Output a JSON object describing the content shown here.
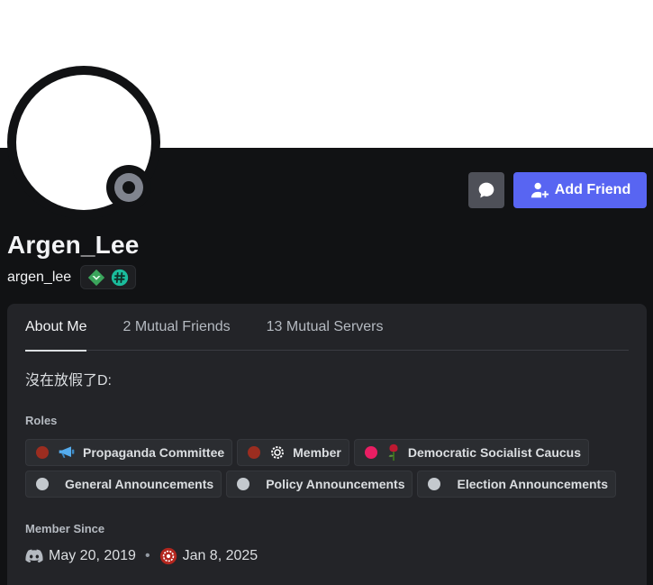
{
  "profile": {
    "display_name": "Argen_Lee",
    "username": "argen_lee",
    "badges": [
      "hypesquad-icon",
      "hashtag-badge-icon"
    ],
    "status": "offline"
  },
  "actions": {
    "message_icon": "chat-bubble-icon",
    "add_friend_label": "Add Friend"
  },
  "tabs": [
    {
      "label": "About Me",
      "active": true
    },
    {
      "label": "2 Mutual Friends",
      "active": false
    },
    {
      "label": "13 Mutual Servers",
      "active": false
    }
  ],
  "about": {
    "bio": "沒在放假了D:"
  },
  "roles": {
    "title": "Roles",
    "items": [
      {
        "label": "Propaganda Committee",
        "color": "#9b2d20",
        "icon": "megaphone-icon"
      },
      {
        "label": "Member",
        "color": "#9b2d20",
        "icon": "gear-emblem-icon"
      },
      {
        "label": "Democratic Socialist Caucus",
        "color": "#e91e63",
        "icon": "rose-icon"
      },
      {
        "label": "General Announcements",
        "color": "#c4c9ce",
        "icon": ""
      },
      {
        "label": "Policy Announcements",
        "color": "#c4c9ce",
        "icon": ""
      },
      {
        "label": "Election Announcements",
        "color": "#c4c9ce",
        "icon": ""
      }
    ]
  },
  "member_since": {
    "title": "Member Since",
    "discord_date": "May 20, 2019",
    "separator": "•",
    "server_date": "Jan 8, 2025"
  },
  "colors": {
    "accent": "#5865f2",
    "background": "#111214",
    "card": "#232428"
  }
}
